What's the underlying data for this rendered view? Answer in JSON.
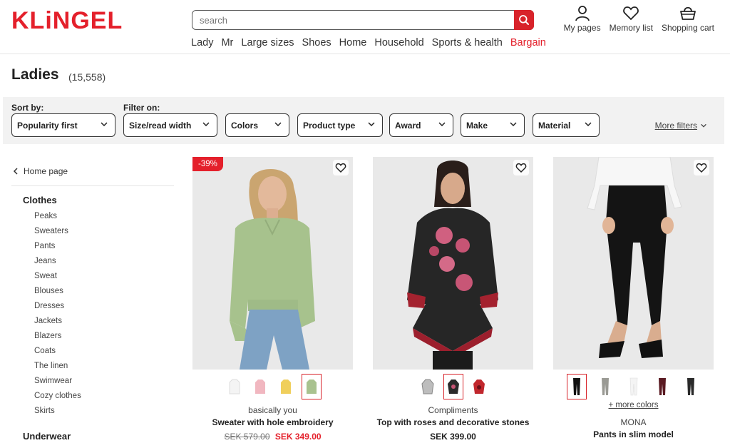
{
  "header": {
    "logo": "KLiNGEL",
    "search_placeholder": "search",
    "nav": [
      "Lady",
      "Mr",
      "Large sizes",
      "Shoes",
      "Home",
      "Household",
      "Sports & health",
      "Bargain"
    ],
    "icons": [
      {
        "label": "My pages",
        "icon": "user-icon"
      },
      {
        "label": "Memory list",
        "icon": "heart-icon"
      },
      {
        "label": "Shopping cart",
        "icon": "basket-icon"
      }
    ]
  },
  "page": {
    "title": "Ladies",
    "count": "(15,558)"
  },
  "filters": {
    "sort_label": "Sort by:",
    "sort_value": "Popularity first",
    "filter_label": "Filter on:",
    "options": [
      "Size/read width",
      "Colors",
      "Product type",
      "Award",
      "Make",
      "Material"
    ],
    "more": "More filters"
  },
  "sidebar": {
    "home": "Home page",
    "category": "Clothes",
    "items": [
      "Peaks",
      "Sweaters",
      "Pants",
      "Jeans",
      "Sweat",
      "Blouses",
      "Dresses",
      "Jackets",
      "Blazers",
      "Coats",
      "The linen",
      "Swimwear",
      "Cozy clothes",
      "Skirts"
    ],
    "next_category": "Underwear"
  },
  "products": [
    {
      "badge": "-39%",
      "brand": "basically you",
      "name": "Sweater with hole embroidery",
      "old_price": "SEK 579.00",
      "price": "SEK 349.00",
      "swatches": [
        "#f2f2f2",
        "#f1b7c0",
        "#f0cf5c",
        "#a9c28f"
      ],
      "selected": 3
    },
    {
      "brand": "Compliments",
      "name": "Top with roses and decorative stones",
      "price": "SEK 399.00",
      "swatches": [
        "#9a9a9a",
        "#b52336",
        "#c1272d"
      ],
      "selected": 1
    },
    {
      "more_colors": "+ more colors",
      "brand": "MONA",
      "name": "Pants in slim model",
      "swatches": [
        "#111111",
        "#9a9a94",
        "#f4f4f4",
        "#5a1a22",
        "#2a2a2a"
      ],
      "selected": 0
    }
  ],
  "colors": {
    "brand_red": "#e4202b",
    "search_btn": "#d8232a"
  }
}
